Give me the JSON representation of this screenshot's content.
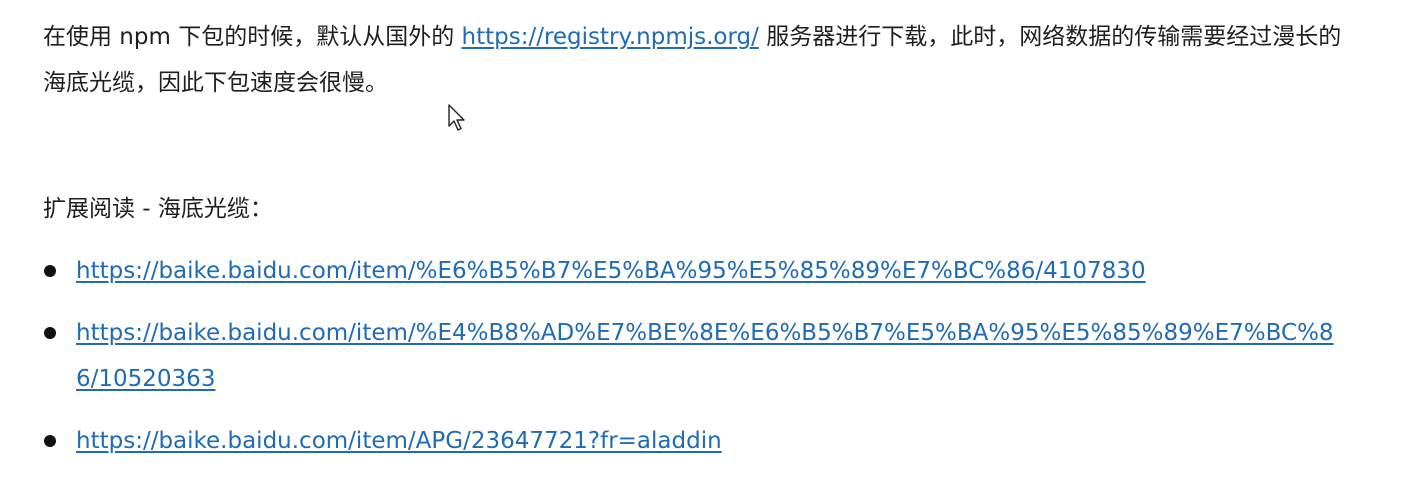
{
  "paragraph": {
    "text_before": "在使用 npm 下包的时候，默认从国外的 ",
    "link": "https://registry.npmjs.org/",
    "text_after": " 服务器进行下载，此时，网络数据的传输需要经过漫长的海底光缆，因此下包速度会很慢。"
  },
  "further_reading": {
    "heading": "扩展阅读 - 海底光缆：",
    "links": [
      "https://baike.baidu.com/item/%E6%B5%B7%E5%BA%95%E5%85%89%E7%BC%86/4107830",
      "https://baike.baidu.com/item/%E4%B8%AD%E7%BE%8E%E6%B5%B7%E5%BA%95%E5%85%89%E7%BC%86/10520363",
      "https://baike.baidu.com/item/APG/23647721?fr=aladdin"
    ]
  },
  "icons": {
    "cursor": "mouse-pointer-icon",
    "bullet": "bullet-dot-icon"
  }
}
